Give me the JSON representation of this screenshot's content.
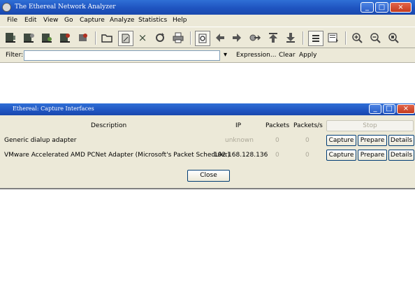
{
  "main_window": {
    "title": "The Ethereal Network Analyzer",
    "controls": {
      "minimize": "_",
      "maximize": "□",
      "close": "×"
    }
  },
  "menu": [
    "File",
    "Edit",
    "View",
    "Go",
    "Capture",
    "Analyze",
    "Statistics",
    "Help"
  ],
  "toolbar": {
    "icons": [
      "capture-interfaces-icon",
      "capture-options-icon",
      "capture-start-icon",
      "capture-stop-icon",
      "capture-restart-icon",
      "open-file-icon",
      "save-file-icon",
      "close-file-icon",
      "reload-icon",
      "print-icon",
      "find-packet-icon",
      "go-back-icon",
      "go-forward-icon",
      "go-to-packet-icon",
      "go-first-icon",
      "go-last-icon",
      "colorize-icon",
      "auto-scroll-icon",
      "zoom-in-icon",
      "zoom-out-icon",
      "normal-size-icon"
    ],
    "close_glyph": "×"
  },
  "filter_bar": {
    "label": "Filter:",
    "value": "",
    "dropdown_glyph": "▾",
    "expression_label": "Expression...",
    "clear_label": "Clear",
    "apply_label": "Apply"
  },
  "dialog": {
    "title": "Ethereal: Capture Interfaces",
    "controls": {
      "minimize": "_",
      "maximize": "□",
      "close": "×"
    },
    "columns": {
      "description": "Description",
      "ip": "IP",
      "packets": "Packets",
      "packets_per_sec": "Packets/s"
    },
    "stop_label": "Stop",
    "interfaces": [
      {
        "description": "Generic dialup adapter",
        "ip": "unknown",
        "packets": "0",
        "packets_per_sec": "0",
        "capture_label": "Capture",
        "prepare_label": "Prepare",
        "details_label": "Details"
      },
      {
        "description": "VMware Accelerated AMD PCNet Adapter (Microsoft's Packet Scheduler)",
        "ip": "192.168.128.136",
        "packets": "0",
        "packets_per_sec": "0",
        "capture_label": "Capture",
        "prepare_label": "Prepare",
        "details_label": "Details"
      }
    ],
    "close_label": "Close"
  }
}
